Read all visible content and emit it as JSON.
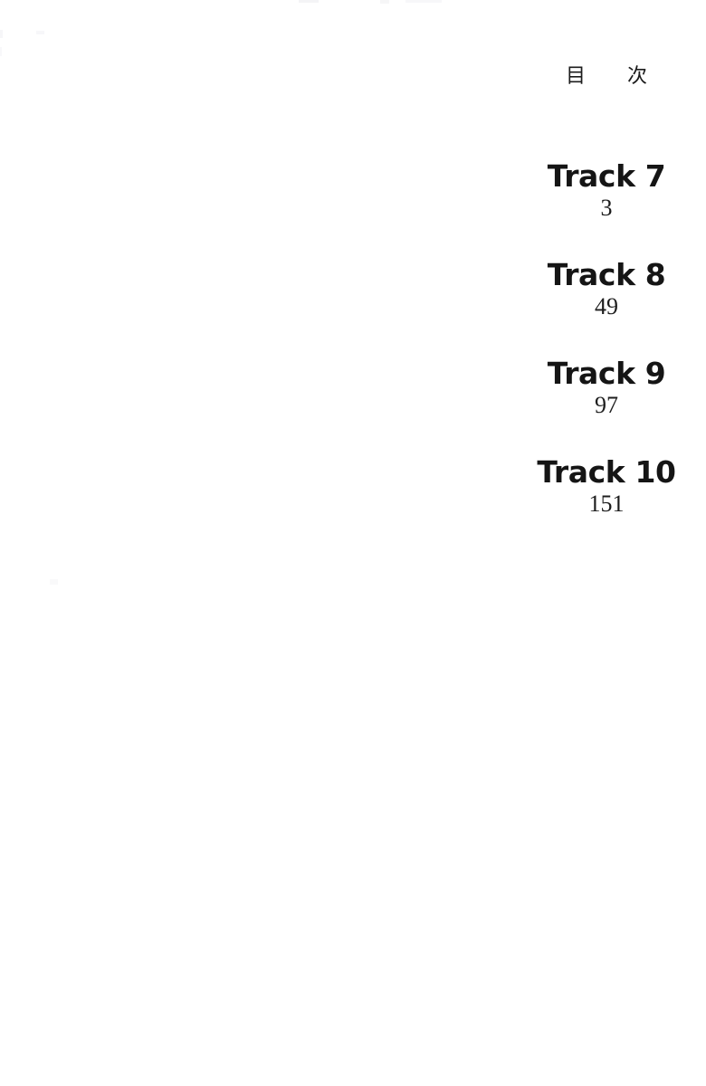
{
  "page": {
    "title": "目　次",
    "title_chars": [
      "目",
      "次"
    ],
    "background_color": "#ffffff",
    "text_color": "#151515",
    "page_number_color": "#1d1d1d"
  },
  "contents": {
    "entries": [
      {
        "heading": "Track 7",
        "page": "3"
      },
      {
        "heading": "Track 8",
        "page": "49"
      },
      {
        "heading": "Track 9",
        "page": "97"
      },
      {
        "heading": "Track 10",
        "page": "151"
      }
    ]
  }
}
